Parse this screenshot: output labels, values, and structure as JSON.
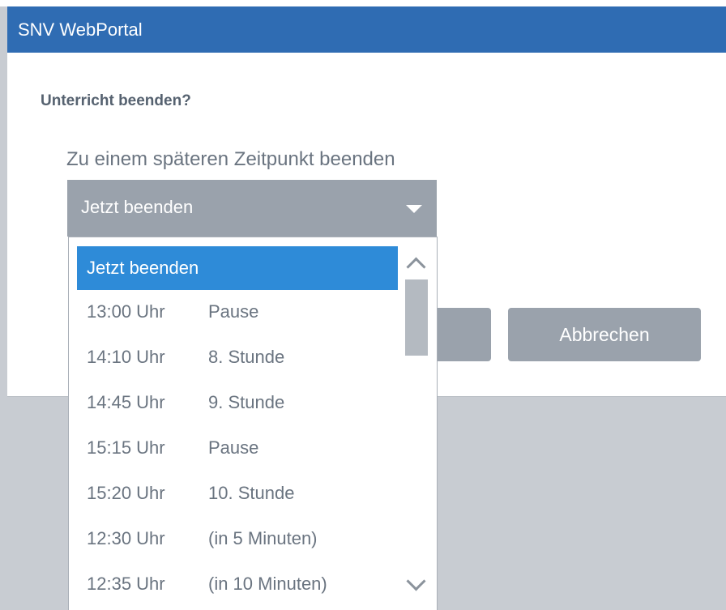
{
  "app": {
    "title": "SNV WebPortal"
  },
  "dialog": {
    "heading": "Unterricht beenden?",
    "later_label": "Zu einem späteren Zeitpunkt beenden",
    "select": {
      "value": "Jetzt beenden"
    },
    "buttons": {
      "ok": "",
      "cancel": "Abbrechen"
    }
  },
  "dropdown": {
    "options": [
      {
        "label": "Jetzt beenden",
        "selected": true
      },
      {
        "time": "13:00 Uhr",
        "desc": "Pause"
      },
      {
        "time": "14:10 Uhr",
        "desc": "8. Stunde"
      },
      {
        "time": "14:45 Uhr",
        "desc": "9. Stunde"
      },
      {
        "time": "15:15 Uhr",
        "desc": "Pause"
      },
      {
        "time": "15:20 Uhr",
        "desc": "10. Stunde"
      },
      {
        "time": "12:30  Uhr",
        "desc": "(in 5 Minuten)"
      },
      {
        "time": "12:35  Uhr",
        "desc": "(in 10 Minuten)"
      }
    ]
  },
  "icons": {
    "caret": "chevron-down-icon",
    "scroll_up": "chevron-up-icon",
    "scroll_down": "chevron-down-icon"
  },
  "colors": {
    "titlebar": "#2f6cb3",
    "selected_option": "#2e8bd8",
    "control_gray": "#9aa2ac",
    "overlay": "#c8ccd2"
  }
}
